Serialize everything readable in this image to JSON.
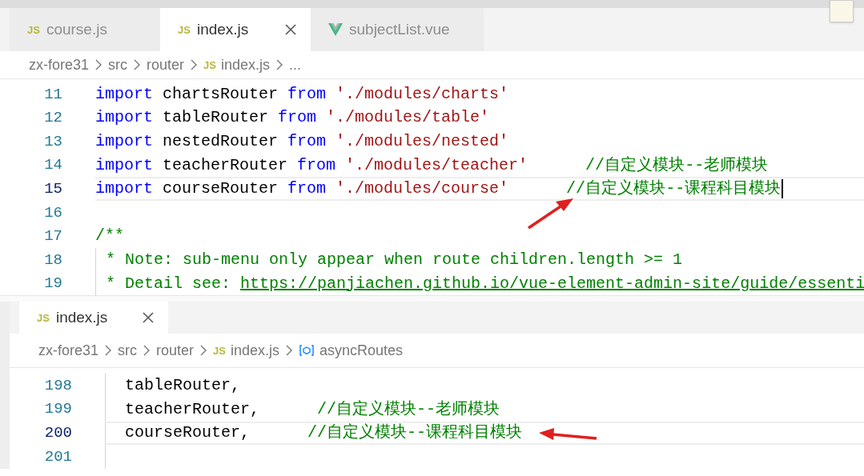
{
  "top_pane": {
    "tabs": [
      {
        "label": "course.js",
        "kind": "js",
        "badge": "JS",
        "selected": false
      },
      {
        "label": "index.js",
        "kind": "js",
        "badge": "JS",
        "selected": true
      },
      {
        "label": "subjectList.vue",
        "kind": "vue",
        "selected": false
      }
    ],
    "breadcrumb": [
      {
        "text": "zx-fore31",
        "kind": "folder"
      },
      {
        "text": "src",
        "kind": "folder"
      },
      {
        "text": "router",
        "kind": "folder"
      },
      {
        "text": "index.js",
        "kind": "js",
        "badge": "JS"
      },
      {
        "text": "...",
        "kind": "folder"
      }
    ],
    "lines": [
      {
        "number": "11",
        "current": false,
        "guide": false,
        "tokens": [
          {
            "kind": "keyword",
            "text": "import"
          },
          {
            "kind": "plain",
            "text": " chartsRouter "
          },
          {
            "kind": "keyword",
            "text": "from"
          },
          {
            "kind": "string",
            "text": " './modules/charts'"
          }
        ]
      },
      {
        "number": "12",
        "current": false,
        "guide": false,
        "tokens": [
          {
            "kind": "keyword",
            "text": "import"
          },
          {
            "kind": "plain",
            "text": " tableRouter "
          },
          {
            "kind": "keyword",
            "text": "from"
          },
          {
            "kind": "string",
            "text": " './modules/table'"
          }
        ]
      },
      {
        "number": "13",
        "current": false,
        "guide": false,
        "tokens": [
          {
            "kind": "keyword",
            "text": "import"
          },
          {
            "kind": "plain",
            "text": " nestedRouter "
          },
          {
            "kind": "keyword",
            "text": "from"
          },
          {
            "kind": "string",
            "text": " './modules/nested'"
          }
        ]
      },
      {
        "number": "14",
        "current": false,
        "guide": false,
        "tokens": [
          {
            "kind": "keyword",
            "text": "import"
          },
          {
            "kind": "plain",
            "text": " teacherRouter "
          },
          {
            "kind": "keyword",
            "text": "from"
          },
          {
            "kind": "string",
            "text": " './modules/teacher'"
          },
          {
            "kind": "comment",
            "text": "      //自定义模块--老师模块"
          }
        ]
      },
      {
        "number": "15",
        "current": true,
        "guide": false,
        "tokens": [
          {
            "kind": "keyword",
            "text": "import"
          },
          {
            "kind": "plain",
            "text": " courseRouter "
          },
          {
            "kind": "keyword",
            "text": "from"
          },
          {
            "kind": "string",
            "text": " './modules/course'"
          },
          {
            "kind": "comment",
            "text": "      //自定义模块--课程科目模块"
          }
        ]
      },
      {
        "number": "16",
        "current": false,
        "guide": false
      },
      {
        "number": "17",
        "current": false,
        "guide": false,
        "tokens": [
          {
            "kind": "comment",
            "text": "/**"
          }
        ]
      },
      {
        "number": "18",
        "current": false,
        "guide": true,
        "tokens": [
          {
            "kind": "comment",
            "text": " * Note: sub-menu only appear when route children.length >= 1"
          }
        ]
      },
      {
        "number": "19",
        "current": false,
        "guide": true,
        "tokens": [
          {
            "kind": "comment",
            "text": " * Detail see: "
          },
          {
            "kind": "link",
            "text": "https://panjiachen.github.io/vue-element-admin-site/guide/essenti"
          }
        ]
      }
    ]
  },
  "bottom_pane": {
    "tabs": [
      {
        "label": "index.js",
        "kind": "js",
        "badge": "JS",
        "selected": true
      }
    ],
    "breadcrumb": [
      {
        "text": "zx-fore31",
        "kind": "folder"
      },
      {
        "text": "src",
        "kind": "folder"
      },
      {
        "text": "router",
        "kind": "folder"
      },
      {
        "text": "index.js",
        "kind": "js",
        "badge": "JS"
      },
      {
        "text": "asyncRoutes",
        "kind": "symbol"
      }
    ],
    "lines": [
      {
        "number": "198",
        "current": false,
        "guide": true,
        "tokens": [
          {
            "kind": "plain",
            "text": "  tableRouter,"
          }
        ]
      },
      {
        "number": "199",
        "current": false,
        "guide": true,
        "tokens": [
          {
            "kind": "plain",
            "text": "  teacherRouter,"
          },
          {
            "kind": "comment",
            "text": "      //自定义模块--老师模块"
          }
        ]
      },
      {
        "number": "200",
        "current": true,
        "guide": true,
        "tokens": [
          {
            "kind": "plain",
            "text": "  courseRouter,"
          },
          {
            "kind": "comment",
            "text": "      //自定义模块--课程科目模块"
          }
        ]
      },
      {
        "number": "201",
        "current": false,
        "guide": true
      }
    ]
  }
}
